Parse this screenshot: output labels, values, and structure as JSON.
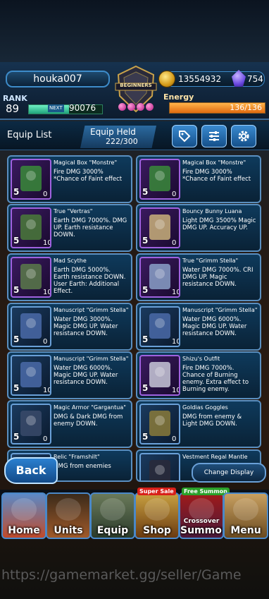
{
  "player": {
    "name": "houka007",
    "rank_label": "RANK",
    "rank": "89",
    "next_label": "NEXT",
    "next_exp": "90076",
    "exp_progress": 0.55
  },
  "currency": {
    "gold": "13554932",
    "gems": "754"
  },
  "energy": {
    "label": "Energy",
    "value": "136/136",
    "progress": 1.0
  },
  "badge": {
    "label": "BEGINNERS"
  },
  "list": {
    "title": "Equip List",
    "held_title": "Equip Held",
    "held_count": "222/300"
  },
  "items": [
    {
      "name": "Magical Box \"Monstre\"",
      "desc": "Fire DMG 3000% *Chance of Faint effect",
      "level": "5",
      "count": "0",
      "frame": "purple"
    },
    {
      "name": "Magical Box \"Monstre\"",
      "desc": "Fire DMG 3000% *Chance of Faint effect",
      "level": "5",
      "count": "0",
      "frame": "purple"
    },
    {
      "name": "True \"Vertras\"",
      "desc": "Earth DMG 7000%. DMG UP. Earth resistance DOWN.",
      "level": "5",
      "count": "10",
      "frame": "purple"
    },
    {
      "name": "Bouncy Bunny Luana",
      "desc": "Light DMG 3500% Magic DMG UP. Accuracy UP.",
      "level": "5",
      "count": "0",
      "frame": "purple"
    },
    {
      "name": "Mad Scythe",
      "desc": "Earth DMG 5000%. Earth resistance DOWN. User Earth: Additional Effect.",
      "level": "5",
      "count": "10",
      "frame": "purple"
    },
    {
      "name": "True \"Grimm Stella\"",
      "desc": "Water DMG 7000%. CRI DMG UP. Magic resistance DOWN.",
      "level": "5",
      "count": "10",
      "frame": "purple"
    },
    {
      "name": "Manuscript \"Grimm Stella\"",
      "desc": "Water DMG 3000%. Magic DMG UP. Water resistance DOWN.",
      "level": "5",
      "count": "0",
      "frame": "blue"
    },
    {
      "name": "Manuscript \"Grimm Stella\"",
      "desc": "Water DMG 6000%. Magic DMG UP. Water resistance DOWN.",
      "level": "5",
      "count": "10",
      "frame": "blue"
    },
    {
      "name": "Manuscript \"Grimm Stella\"",
      "desc": "Water DMG 6000%. Magic DMG UP. Water resistance DOWN.",
      "level": "5",
      "count": "10",
      "frame": "blue"
    },
    {
      "name": "Shizu's Outfit",
      "desc": "Fire DMG 7000%. Chance of Burning enemy. Extra effect to Burning enemy.",
      "level": "5",
      "count": "10",
      "frame": "purple"
    },
    {
      "name": "Magic Armor \"Gargantua\"",
      "desc": "DMG & Dark DMG from enemy DOWN.",
      "level": "5",
      "count": "0",
      "frame": "blue"
    },
    {
      "name": "Goldias Goggles",
      "desc": "DMG from enemy & Light DMG DOWN.",
      "level": "5",
      "count": "0",
      "frame": "blue"
    },
    {
      "name": "Relic \"Framshilt\"",
      "desc": "DMG from enemies",
      "level": "",
      "count": "",
      "frame": "blue"
    },
    {
      "name": "Vestment Regal Mantle",
      "desc": "",
      "level": "",
      "count": "",
      "frame": "blue"
    }
  ],
  "buttons": {
    "back": "Back",
    "change_display": "Change Display"
  },
  "nav": [
    {
      "label": "Home"
    },
    {
      "label": "Units"
    },
    {
      "label": "Equip"
    },
    {
      "label": "Shop",
      "tag": "Super Sale"
    },
    {
      "label": "Summon",
      "tag": "Free Summon",
      "sub": "Crossover"
    },
    {
      "label": "Menu"
    }
  ],
  "watermark": "https://gamemarket.gg/seller/Game",
  "colors": {
    "accent": "#3d8bc9",
    "energy": "#e06a10",
    "exp": "#1fa27a",
    "tag_red": "#d8201a",
    "tag_green": "#2aa02a"
  }
}
